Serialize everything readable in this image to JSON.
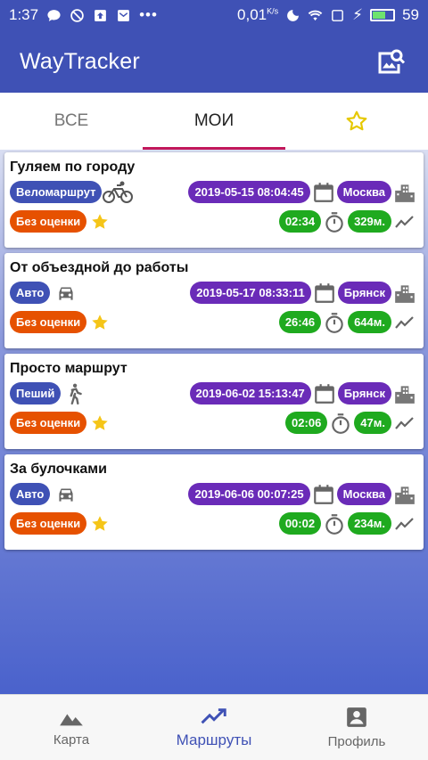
{
  "statusbar": {
    "time": "1:37",
    "network_speed": "0,01",
    "network_unit": "K/s",
    "battery_level": "59"
  },
  "appbar": {
    "title": "WayTracker",
    "action_icon": "image-search-icon"
  },
  "tabs": [
    {
      "label": "ВСЕ",
      "active": false
    },
    {
      "label": "МОИ",
      "active": true
    },
    {
      "label": "",
      "icon": "star-icon",
      "active": false
    }
  ],
  "routes": [
    {
      "title": "Гуляем по городу",
      "type": "Веломаршрут",
      "type_icon": "bicycle-icon",
      "datetime": "2019-05-15 08:04:45",
      "city": "Москва",
      "rating": "Без оценки",
      "duration": "02:34",
      "distance": "329м."
    },
    {
      "title": "От объездной до работы",
      "type": "Авто",
      "type_icon": "car-icon",
      "datetime": "2019-05-17 08:33:11",
      "city": "Брянск",
      "rating": "Без оценки",
      "duration": "26:46",
      "distance": "644м."
    },
    {
      "title": "Просто маршрут",
      "type": "Пеший",
      "type_icon": "walk-icon",
      "datetime": "2019-06-02 15:13:47",
      "city": "Брянск",
      "rating": "Без оценки",
      "duration": "02:06",
      "distance": "47м."
    },
    {
      "title": "За булочками",
      "type": "Авто",
      "type_icon": "car-icon",
      "datetime": "2019-06-06 00:07:25",
      "city": "Москва",
      "rating": "Без оценки",
      "duration": "00:02",
      "distance": "234м."
    }
  ],
  "bottomnav": [
    {
      "label": "Карта",
      "icon": "terrain-icon",
      "active": false
    },
    {
      "label": "Маршруты",
      "icon": "trending-up-icon",
      "active": true
    },
    {
      "label": "Профиль",
      "icon": "account-box-icon",
      "active": false
    }
  ],
  "colors": {
    "primary": "#3f51b5",
    "accent": "#c2185b",
    "type_pill": "#3f51b5",
    "date_pill": "#6a2bb8",
    "rating_pill": "#e65100",
    "stat_pill": "#1faa1f",
    "star": "#f5c518"
  }
}
